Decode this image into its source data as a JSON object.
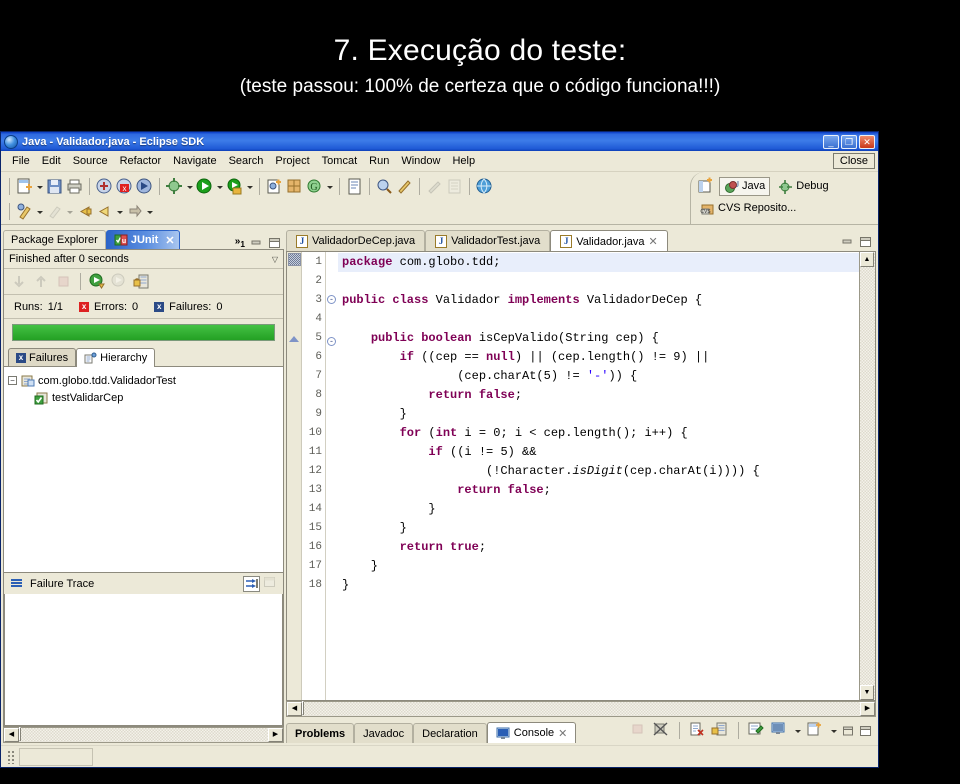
{
  "slide": {
    "title": "7. Execução do teste:",
    "subtitle": "(teste passou: 100% de certeza que o código funciona!!!)"
  },
  "window": {
    "title": "Java - Validador.java - Eclipse SDK",
    "minimize": "_",
    "restore": "❐",
    "close": "✕"
  },
  "menu": {
    "items": [
      "File",
      "Edit",
      "Source",
      "Refactor",
      "Navigate",
      "Search",
      "Project",
      "Tomcat",
      "Run",
      "Window",
      "Help"
    ],
    "close_label": "Close"
  },
  "perspective": {
    "open_tooltip": "Open Perspective",
    "items": [
      {
        "label": "Java",
        "active": true
      },
      {
        "label": "Debug",
        "active": false
      },
      {
        "label": "CVS Reposito...",
        "active": false
      }
    ]
  },
  "left_panel": {
    "tabs": [
      {
        "label": "Package Explorer",
        "active": false,
        "closable": false
      },
      {
        "label": "JUnit",
        "active": true,
        "closable": true
      }
    ],
    "overflow_indicator": "»",
    "overflow_count": "1",
    "status": "Finished after 0 seconds",
    "counters": {
      "runs_label": "Runs:",
      "runs_value": "1/1",
      "errors_label": "Errors:",
      "errors_value": "0",
      "failures_label": "Failures:",
      "failures_value": "0"
    },
    "progress_percent": 100,
    "progress_color": "#2fae2f",
    "inner_tabs": [
      {
        "label": "Failures",
        "active": false
      },
      {
        "label": "Hierarchy",
        "active": true
      }
    ],
    "tree": {
      "root": "com.globo.tdd.ValidadorTest",
      "child": "testValidarCep"
    },
    "failure_trace_label": "Failure Trace"
  },
  "editor": {
    "tabs": [
      {
        "label": "ValidadorDeCep.java",
        "active": false
      },
      {
        "label": "ValidadorTest.java",
        "active": false
      },
      {
        "label": "Validador.java",
        "active": true
      }
    ],
    "java_icon_letter": "J",
    "lines": [
      {
        "n": "1",
        "html": "<span class=\"kw\">package</span> com.globo.tdd;",
        "highlight": true,
        "fold": ""
      },
      {
        "n": "2",
        "html": "",
        "highlight": false,
        "fold": ""
      },
      {
        "n": "3",
        "html": "<span class=\"kw\">public class</span> Validador <span class=\"kw\">implements</span> ValidadorDeCep {",
        "highlight": false,
        "fold": "-"
      },
      {
        "n": "4",
        "html": "",
        "highlight": false,
        "fold": ""
      },
      {
        "n": "5",
        "html": "    <span class=\"kw\">public boolean</span> isCepValido(String cep) {",
        "highlight": false,
        "fold": "-"
      },
      {
        "n": "6",
        "html": "        <span class=\"kw\">if</span> ((cep == <span class=\"kw\">null</span>) || (cep.length() != 9) ||",
        "highlight": false,
        "fold": ""
      },
      {
        "n": "7",
        "html": "                (cep.charAt(5) != <span class=\"str\">'-'</span>)) {",
        "highlight": false,
        "fold": ""
      },
      {
        "n": "8",
        "html": "            <span class=\"kw\">return false</span>;",
        "highlight": false,
        "fold": ""
      },
      {
        "n": "9",
        "html": "        }",
        "highlight": false,
        "fold": ""
      },
      {
        "n": "10",
        "html": "        <span class=\"kw\">for</span> (<span class=\"kw\">int</span> i = 0; i &lt; cep.length(); i++) {",
        "highlight": false,
        "fold": ""
      },
      {
        "n": "11",
        "html": "            <span class=\"kw\">if</span> ((i != 5) &amp;&amp;",
        "highlight": false,
        "fold": ""
      },
      {
        "n": "12",
        "html": "                    (!Character.<span class=\"stat\">isDigit</span>(cep.charAt(i)))) {",
        "highlight": false,
        "fold": ""
      },
      {
        "n": "13",
        "html": "                <span class=\"kw\">return false</span>;",
        "highlight": false,
        "fold": ""
      },
      {
        "n": "14",
        "html": "            }",
        "highlight": false,
        "fold": ""
      },
      {
        "n": "15",
        "html": "        }",
        "highlight": false,
        "fold": ""
      },
      {
        "n": "16",
        "html": "        <span class=\"kw\">return true</span>;",
        "highlight": false,
        "fold": ""
      },
      {
        "n": "17",
        "html": "    }",
        "highlight": false,
        "fold": ""
      },
      {
        "n": "18",
        "html": "}",
        "highlight": false,
        "fold": ""
      }
    ]
  },
  "bottom_panel": {
    "tabs": [
      {
        "label": "Problems",
        "active": false,
        "bold": true
      },
      {
        "label": "Javadoc",
        "active": false,
        "bold": false
      },
      {
        "label": "Declaration",
        "active": false,
        "bold": false
      },
      {
        "label": "Console",
        "active": true,
        "bold": false
      }
    ]
  },
  "colors": {
    "keyword": "#7f0055",
    "string": "#2a00ff",
    "titlebar": "#2f6ae0",
    "chrome": "#ece9d8",
    "success_green": "#2fae2f"
  }
}
